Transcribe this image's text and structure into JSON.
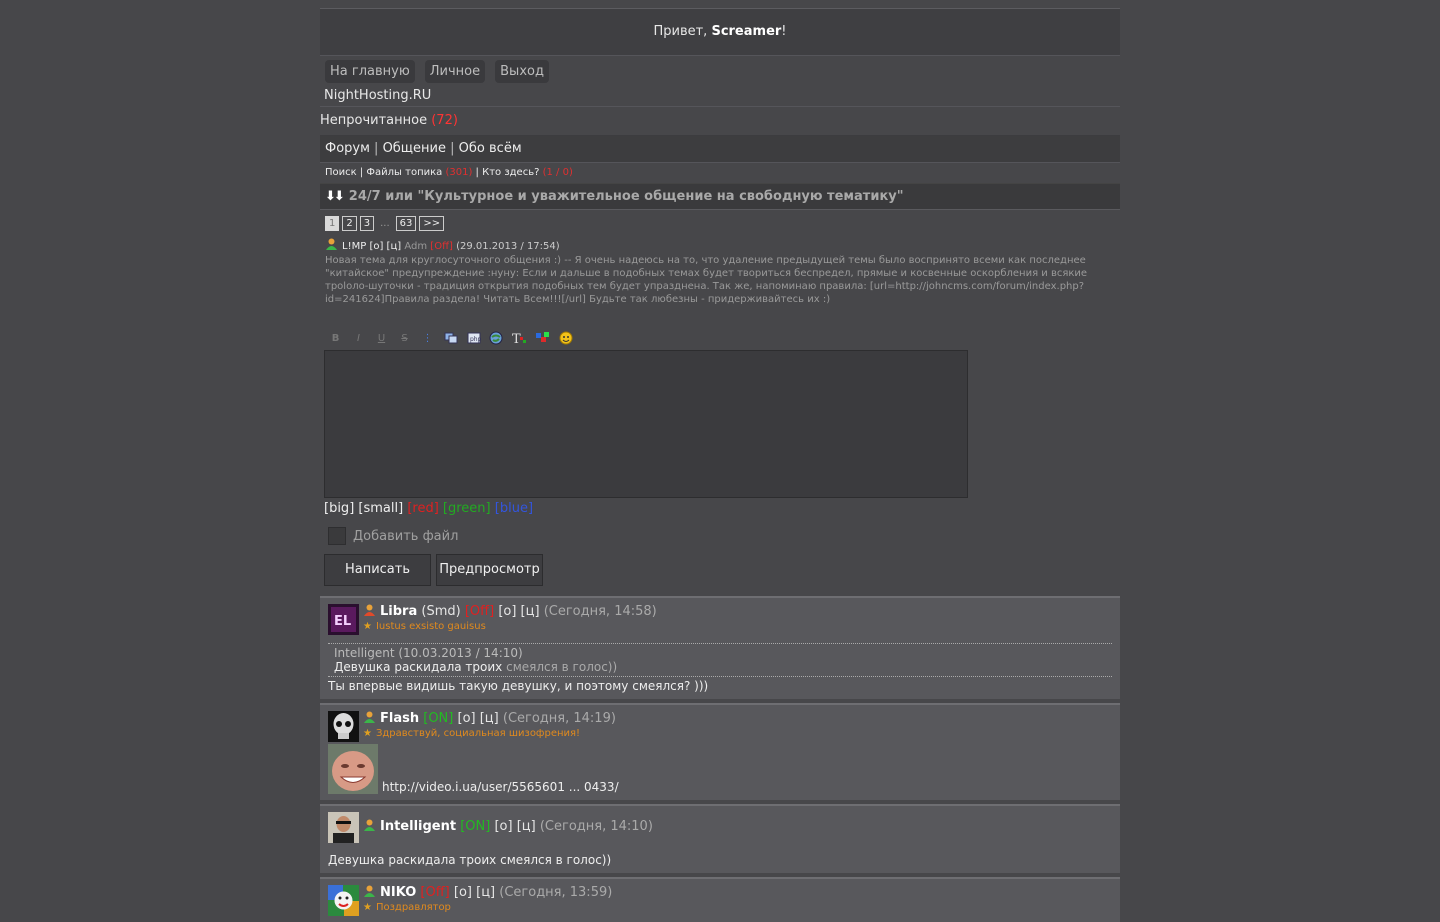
{
  "header": {
    "greeting": "Привет, ",
    "username": "Screamer",
    "exclaim": "!"
  },
  "nav": {
    "home": "На главную",
    "personal": "Личное",
    "exit": "Выход"
  },
  "site_name": "NightHosting.RU",
  "unread": {
    "label": "Непрочитанное ",
    "count": "(72)"
  },
  "breadcrumb": {
    "forum": "Форум",
    "section": "Общение",
    "subsection": "Обо всём",
    "sep": " | "
  },
  "toplinks": {
    "search": "Поиск",
    "files": "Файлы топика",
    "files_count": "(301)",
    "who": "Кто здесь?",
    "who_count": "(1 / 0)"
  },
  "topic": {
    "arrows": "⬇⬇",
    "title": "24/7 или \"Культурное и уважительное общение на свободную тематику\""
  },
  "pager": {
    "pages": [
      "1",
      "2",
      "3"
    ],
    "dots": "...",
    "last": "63",
    "next": ">>"
  },
  "first_post": {
    "author": "L!MP",
    "links": "[о] [ц]",
    "role": "Adm",
    "status": "[Off]",
    "date": "(29.01.2013 / 17:54)",
    "text": "Новая тема для круглосуточного общения :) -- Я очень надеюсь на то, что удаление предыдущей темы было воспринято всеми как последнее \"китайское\" предупреждение :нуну: Если и дальше в подобных темах будет твориться беспредел, прямые и косвенные оскорбления и всякие троloло-шуточки - традиция открытия подобных тем будет упразднена. Так же, напоминаю правила: [url=http://johncms.com/forum/index.php?id=241624]Правила раздела! Читать Всем!!![/url] Будьте так любезны - придерживайтесь их :)"
  },
  "toolbar": {
    "bold": "B",
    "italic": "I",
    "underline": "U",
    "strike": "S",
    "list": "⋮",
    "icons": [
      "copy-icon",
      "code-icon",
      "link-icon",
      "text-icon",
      "color-icon",
      "smile-icon"
    ]
  },
  "tags": {
    "big": "[big]",
    "small": "[small]",
    "red": "[red]",
    "green": "[green]",
    "blue": "[blue]"
  },
  "attach_label": "Добавить файл",
  "buttons": {
    "write": "Написать",
    "preview": "Предпросмотр"
  },
  "posts": [
    {
      "nick": "Libra",
      "role": "(Smd)",
      "state": "[Off]",
      "links": "[о] [ц]",
      "time": "(Сегодня, 14:58)",
      "status": "Iustus exsisto gauisus",
      "quote_head": "Intelligent (10.03.2013 / 14:10)",
      "quote_text": "Девушка раскидала троих ",
      "quote_tail": "смеялся в голос))",
      "text": "Ты впервые видишь такую девушку, и поэтому смеялся? )))"
    },
    {
      "nick": "Flash",
      "state": "[ON]",
      "links": "[о] [ц]",
      "time": "(Сегодня, 14:19)",
      "status": "Здравствуй, социальная шизофрения!",
      "text": "http://video.i.ua/user/5565601 ... 0433/"
    },
    {
      "nick": "Intelligent",
      "state": "[ON]",
      "links": "[о] [ц]",
      "time": "(Сегодня, 14:10)",
      "text": "Девушка раскидала троих смеялся в голос))"
    },
    {
      "nick": "NIKO",
      "state": "[Off]",
      "links": "[о] [ц]",
      "time": "(Сегодня, 13:59)",
      "status": "Поздравлятор"
    }
  ]
}
